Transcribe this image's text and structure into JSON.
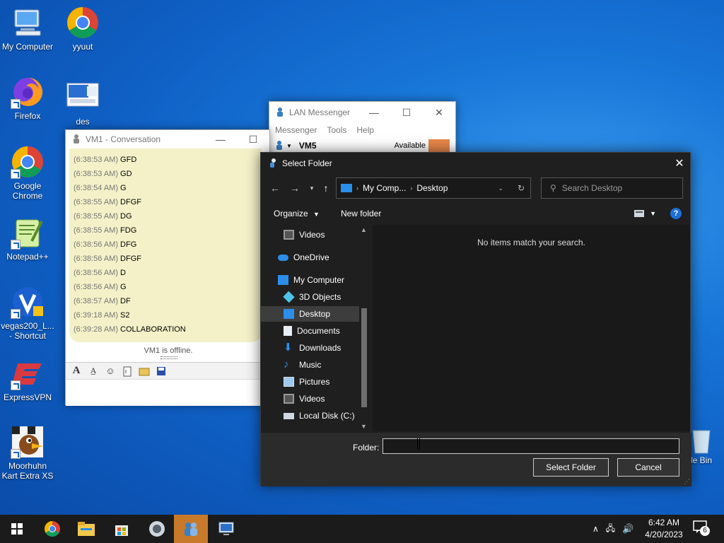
{
  "desktop": {
    "icons": [
      {
        "label": "My Computer"
      },
      {
        "label": "yyuut"
      },
      {
        "label": "Firefox"
      },
      {
        "label": "des"
      },
      {
        "label": "Google Chrome"
      },
      {
        "label": "Notepad++"
      },
      {
        "label": "vegas200_L... - Shortcut"
      },
      {
        "label": "ExpressVPN"
      },
      {
        "label": "Moorhuhn Kart Extra XS"
      },
      {
        "label": "le Bin"
      }
    ]
  },
  "lan_messenger": {
    "title": "LAN Messenger",
    "menu": [
      "Messenger",
      "Tools",
      "Help"
    ],
    "user": "VM5",
    "status": "Available"
  },
  "conversation": {
    "title": "VM1 - Conversation",
    "messages": [
      {
        "time": "(6:38:53 AM)",
        "text": "GFD"
      },
      {
        "time": "(6:38:53 AM)",
        "text": "GD"
      },
      {
        "time": "(6:38:54 AM)",
        "text": "G"
      },
      {
        "time": "(6:38:55 AM)",
        "text": "DFGF"
      },
      {
        "time": "(6:38:55 AM)",
        "text": "DG"
      },
      {
        "time": "(6:38:55 AM)",
        "text": "FDG"
      },
      {
        "time": "(6:38:56 AM)",
        "text": "DFG"
      },
      {
        "time": "(6:38:56 AM)",
        "text": "DFGF"
      },
      {
        "time": "(6:38:56 AM)",
        "text": "D"
      },
      {
        "time": "(6:38:56 AM)",
        "text": "G"
      },
      {
        "time": "(6:38:57 AM)",
        "text": "DF"
      },
      {
        "time": "(6:39:18 AM)",
        "text": "S2"
      },
      {
        "time": "(6:39:28 AM)",
        "text": "COLLABORATION"
      }
    ],
    "offline_text": "VM1 is offline."
  },
  "dialog": {
    "title": "Select Folder",
    "address": {
      "part1": "My Comp...",
      "part2": "Desktop"
    },
    "search_placeholder": "Search Desktop",
    "organize": "Organize",
    "new_folder": "New folder",
    "empty_message": "No items match your search.",
    "nav_items": [
      {
        "label": "Videos",
        "icon": "video-icon"
      },
      {
        "label": "OneDrive",
        "icon": "cloud-icon"
      },
      {
        "label": "My Computer",
        "icon": "computer-icon"
      },
      {
        "label": "3D Objects",
        "icon": "cube-icon"
      },
      {
        "label": "Desktop",
        "icon": "desktop-icon"
      },
      {
        "label": "Documents",
        "icon": "document-icon"
      },
      {
        "label": "Downloads",
        "icon": "download-icon"
      },
      {
        "label": "Music",
        "icon": "music-icon"
      },
      {
        "label": "Pictures",
        "icon": "picture-icon"
      },
      {
        "label": "Videos",
        "icon": "video-icon"
      },
      {
        "label": "Local Disk (C:)",
        "icon": "drive-icon"
      }
    ],
    "folder_label": "Folder:",
    "folder_value": "",
    "select_button": "Select Folder",
    "cancel_button": "Cancel"
  },
  "taskbar": {
    "time": "6:42 AM",
    "date": "4/20/2023",
    "notification_count": "6"
  }
}
